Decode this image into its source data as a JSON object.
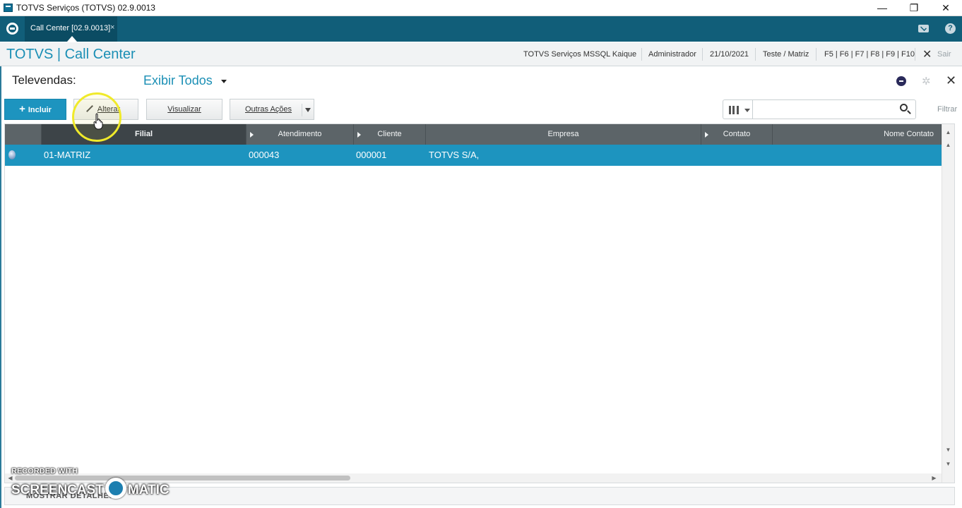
{
  "window": {
    "title": "TOTVS Serviços (TOTVS) 02.9.0013",
    "minimize": "—",
    "restore": "❐",
    "close": "✕"
  },
  "tabbar": {
    "active_tab": "Call Center [02.9.0013]",
    "tab_close": "×",
    "help": "?"
  },
  "app_header": {
    "brand": "TOTVS | Call Center",
    "environment": "TOTVS Serviços MSSQL Kaique",
    "user": "Administrador",
    "date": "21/10/2021",
    "company": "Teste / Matriz",
    "shortcuts": "F5 | F6 | F7 | F8 | F9 | F10",
    "exit_icon": "✕",
    "exit_label": "Sair"
  },
  "browse": {
    "title": "Televendas:",
    "view": "Exibir Todos",
    "config_icon": "✲",
    "close_icon": "✕"
  },
  "toolbar": {
    "incluir": "Incluir",
    "incluir_icon": "+",
    "alterar": "Alterar",
    "visualizar": "Visualizar",
    "outras": "Outras Ações"
  },
  "search": {
    "value": "",
    "filter_label": "Filtrar"
  },
  "grid": {
    "columns": [
      "Filial",
      "Atendimento",
      "Cliente",
      "Empresa",
      "Contato",
      "Nome Contato"
    ],
    "rows": [
      {
        "filial": "01-MATRIZ",
        "atendimento": "000043",
        "cliente": "000001",
        "empresa": "TOTVS S/A,",
        "contato": "",
        "nome_contato": ""
      }
    ],
    "scroll_up": "▲",
    "scroll_top": "▲",
    "scroll_down": "▼",
    "scroll_bottom": "▼",
    "scroll_left": "◀",
    "scroll_right": "▶"
  },
  "footer": {
    "details": "MOSTRAR DETALHES"
  },
  "watermark": {
    "recorded": "RECORDED WITH",
    "brand_left": "SCREENCAST",
    "brand_right": "MATIC"
  },
  "colors": {
    "accent": "#1d94bf",
    "header_dark": "#115e79",
    "grid_header": "#5c6468",
    "highlight": "#f0ea2a"
  }
}
